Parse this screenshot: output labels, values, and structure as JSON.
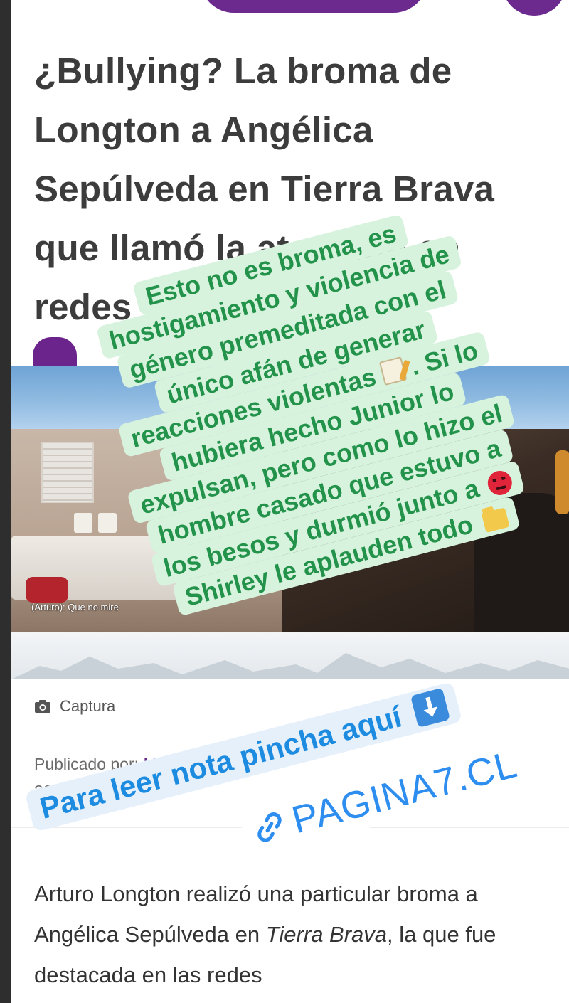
{
  "article": {
    "headline_lines": [
      "¿Bullying? La broma de",
      "Longton a Angélica",
      "Sepúlveda en Tierra Brava",
      "que llamó la atención en",
      "redes"
    ],
    "video_subtitle": "(Arturo): Que no mire",
    "caption": "Captura",
    "byline_prefix": "Publicado por: ",
    "author": "Matías P",
    "date": "22 Noviembre",
    "body_part1": "Arturo Longton realizó una particular broma a Angélica Sepúlveda en ",
    "body_italic1": "Tierra Brava",
    "body_part2": ", la que fue destacada en las redes"
  },
  "story_overlay": {
    "lines": [
      "Esto no es broma, es",
      "hostigamiento y violencia de",
      "género premeditada con el",
      "único afán de generar",
      "reacciones violentas",
      ". Si lo",
      "hubiera hecho Junior lo",
      "expulsan, pero como lo hizo el",
      "hombre casado que estuvo a",
      "los besos y durmió junto a",
      "Shirley le aplauden todo"
    ],
    "emojis": [
      "memo-icon",
      "folder-icon",
      "angry-face-icon"
    ],
    "read_prompt": "Para leer nota pincha aquí",
    "link_label": "PAGINA7.CL"
  },
  "colors": {
    "brand_purple": "#6c2a8f",
    "overlay_green_text": "#23924a",
    "overlay_green_bg": "#d7f2dd",
    "link_blue": "#2d8ef0"
  }
}
